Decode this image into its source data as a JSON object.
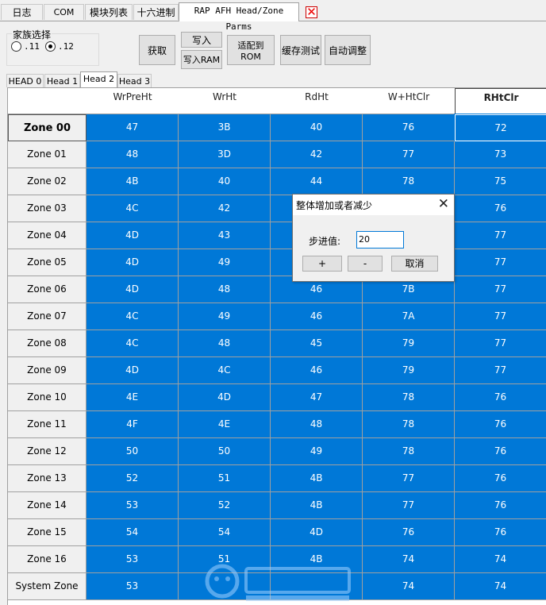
{
  "top_tabs": [
    "日志",
    "COM",
    "模块列表",
    "十六进制",
    "RAP AFH Head/Zone Parms"
  ],
  "family": {
    "label": "家族选择",
    "options": [
      ".11",
      ".12"
    ],
    "selected": ".12"
  },
  "buttons": {
    "get": "获取",
    "write": "写入",
    "write_ram": "写入RAM",
    "adapt_rom": "适配到ROM",
    "cache_test": "缓存测试",
    "auto_adjust": "自动调整"
  },
  "head_tabs": [
    "HEAD 0",
    "Head 1",
    "Head 2",
    "Head 3"
  ],
  "active_head": "Head 2",
  "grid": {
    "columns": [
      "WrPreHt",
      "WrHt",
      "RdHt",
      "W+HtClr",
      "RHtClr"
    ],
    "rows": [
      {
        "zone": "Zone 00",
        "values": [
          "47",
          "3B",
          "40",
          "76",
          "72"
        ]
      },
      {
        "zone": "Zone 01",
        "values": [
          "48",
          "3D",
          "42",
          "77",
          "73"
        ]
      },
      {
        "zone": "Zone 02",
        "values": [
          "4B",
          "40",
          "44",
          "78",
          "75"
        ]
      },
      {
        "zone": "Zone 03",
        "values": [
          "4C",
          "42",
          "",
          "",
          "76"
        ]
      },
      {
        "zone": "Zone 04",
        "values": [
          "4D",
          "43",
          "",
          "",
          "77"
        ]
      },
      {
        "zone": "Zone 05",
        "values": [
          "4D",
          "49",
          "",
          "",
          "77"
        ]
      },
      {
        "zone": "Zone 06",
        "values": [
          "4D",
          "48",
          "46",
          "7B",
          "77"
        ]
      },
      {
        "zone": "Zone 07",
        "values": [
          "4C",
          "49",
          "46",
          "7A",
          "77"
        ]
      },
      {
        "zone": "Zone 08",
        "values": [
          "4C",
          "48",
          "45",
          "79",
          "77"
        ]
      },
      {
        "zone": "Zone 09",
        "values": [
          "4D",
          "4C",
          "46",
          "79",
          "77"
        ]
      },
      {
        "zone": "Zone 10",
        "values": [
          "4E",
          "4D",
          "47",
          "78",
          "76"
        ]
      },
      {
        "zone": "Zone 11",
        "values": [
          "4F",
          "4E",
          "48",
          "78",
          "76"
        ]
      },
      {
        "zone": "Zone 12",
        "values": [
          "50",
          "50",
          "49",
          "78",
          "76"
        ]
      },
      {
        "zone": "Zone 13",
        "values": [
          "52",
          "51",
          "4B",
          "77",
          "76"
        ]
      },
      {
        "zone": "Zone 14",
        "values": [
          "53",
          "52",
          "4B",
          "77",
          "76"
        ]
      },
      {
        "zone": "Zone 15",
        "values": [
          "54",
          "54",
          "4D",
          "76",
          "76"
        ]
      },
      {
        "zone": "Zone 16",
        "values": [
          "53",
          "51",
          "4B",
          "74",
          "74"
        ]
      },
      {
        "zone": "System Zone",
        "values": [
          "53",
          "",
          "",
          "74",
          "74"
        ]
      }
    ]
  },
  "dialog": {
    "title": "整体增加或者减少",
    "step_label": "步进值:",
    "step_value": "20",
    "plus": "+",
    "minus": "-",
    "cancel": "取消"
  },
  "colors": {
    "cell_bg": "#0078d7",
    "close_x": "#e00000"
  },
  "icons": {
    "tab_close": "close-icon",
    "dialog_close": "close-icon"
  }
}
